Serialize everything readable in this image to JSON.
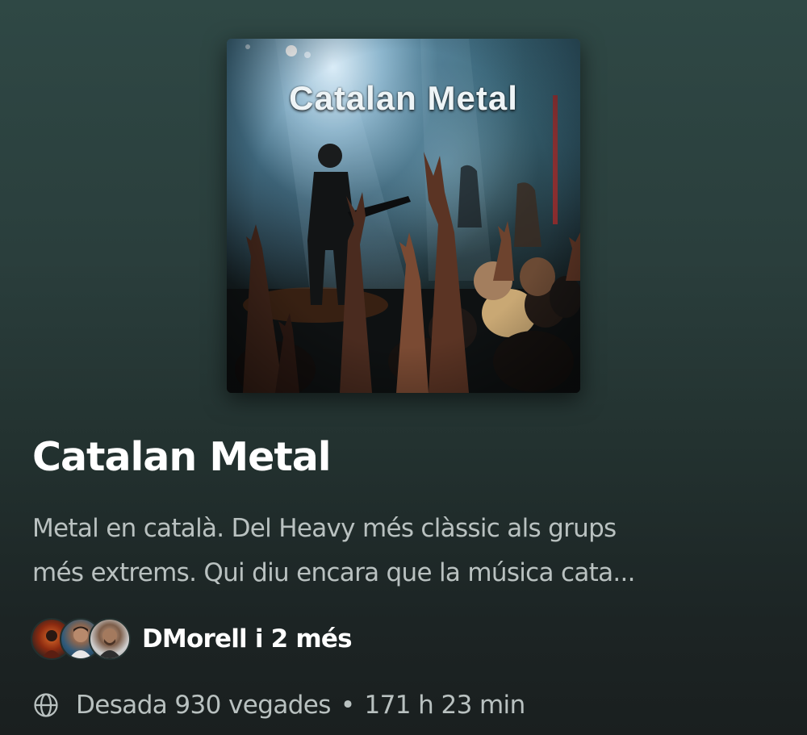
{
  "cover": {
    "title": "Catalan Metal"
  },
  "playlist": {
    "title": "Catalan Metal",
    "description_line1": "Metal en català. Del Heavy més clàssic als grups",
    "description_line2": "més extrems. Qui diu encara que la música cata..."
  },
  "owner": {
    "label": "DMorell i 2 més",
    "avatars": [
      "avatar-1",
      "avatar-2",
      "avatar-3"
    ]
  },
  "stats": {
    "saves": "Desada 930 vegades",
    "separator": "•",
    "duration": "171 h 23 min",
    "icon": "globe-icon"
  },
  "colors": {
    "background_top": "#2f4845",
    "background_bottom": "#1a1f1f",
    "text_primary": "#ffffff",
    "text_secondary": "#b9c1c0"
  }
}
